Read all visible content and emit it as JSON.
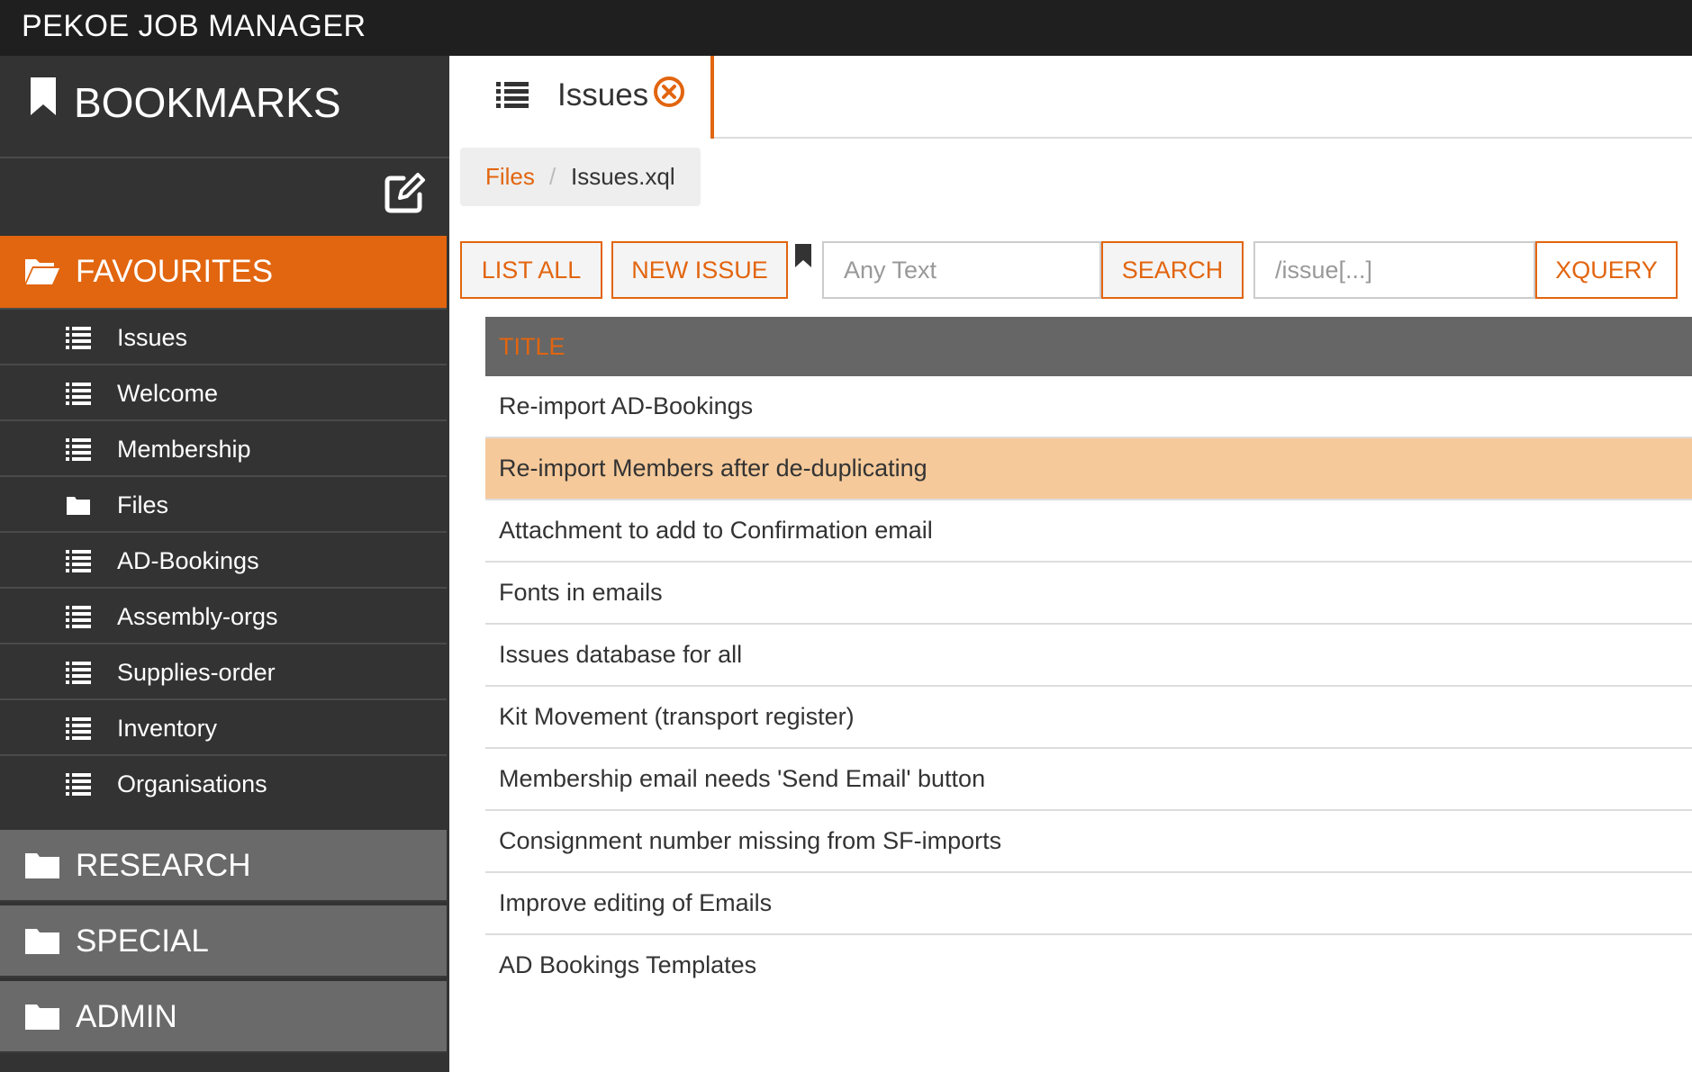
{
  "app": {
    "title": "PEKOE JOB MANAGER"
  },
  "sidebar": {
    "header": "BOOKMARKS",
    "groups": [
      {
        "label": "FAVOURITES",
        "icon": "folder-open-icon",
        "expanded": true
      },
      {
        "label": "RESEARCH",
        "icon": "folder-icon"
      },
      {
        "label": "SPECIAL",
        "icon": "folder-icon"
      },
      {
        "label": "ADMIN",
        "icon": "folder-icon"
      }
    ],
    "favourites": [
      {
        "label": "Issues",
        "icon": "list-icon"
      },
      {
        "label": "Welcome",
        "icon": "list-icon"
      },
      {
        "label": "Membership",
        "icon": "list-icon"
      },
      {
        "label": "Files",
        "icon": "folder-icon"
      },
      {
        "label": "AD-Bookings",
        "icon": "list-icon"
      },
      {
        "label": "Assembly-orgs",
        "icon": "list-icon"
      },
      {
        "label": "Supplies-order",
        "icon": "list-icon"
      },
      {
        "label": "Inventory",
        "icon": "list-icon"
      },
      {
        "label": "Organisations",
        "icon": "list-icon"
      }
    ]
  },
  "tab": {
    "label": "Issues"
  },
  "breadcrumb": {
    "root": "Files",
    "separator": "/",
    "current": "Issues.xql"
  },
  "toolbar": {
    "list_all": "LIST ALL",
    "new_issue": "NEW ISSUE",
    "search_placeholder": "Any Text",
    "search": "SEARCH",
    "xquery_placeholder": "/issue[...]",
    "xquery": "XQUERY"
  },
  "table": {
    "header": "TITLE",
    "selected_index": 1,
    "rows": [
      "Re-import AD-Bookings",
      "Re-import Members after de-duplicating",
      "Attachment to add to Confirmation email",
      "Fonts in emails",
      "Issues database for all",
      "Kit Movement (transport register)",
      "Membership email needs 'Send Email' button",
      "Consignment number missing from SF-imports",
      "Improve editing of Emails",
      "AD Bookings Templates"
    ]
  },
  "colors": {
    "accent": "#e2650f",
    "topbar": "#1f1f1f",
    "sidebar": "#333333",
    "selected_row": "#f5c99a"
  }
}
